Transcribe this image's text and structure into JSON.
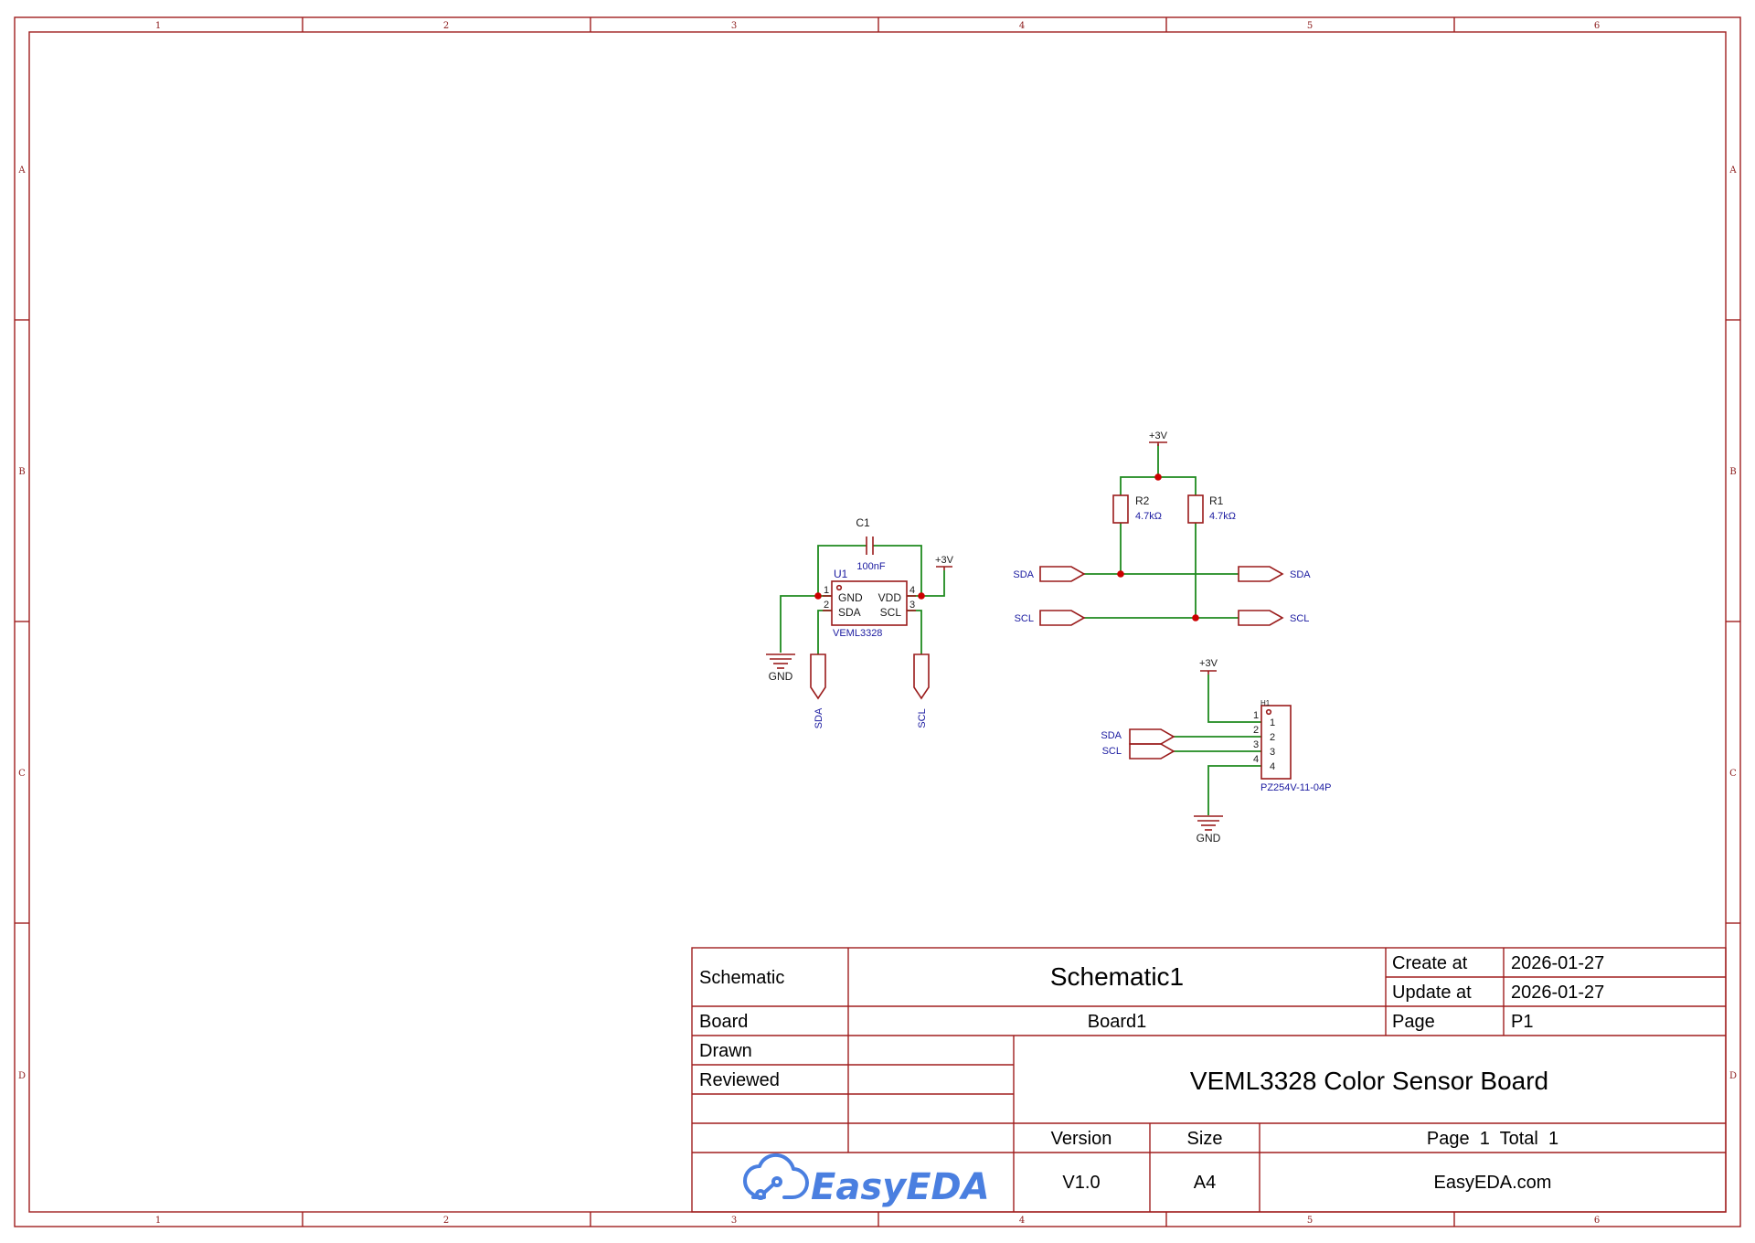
{
  "zones": {
    "columns": [
      "1",
      "2",
      "3",
      "4",
      "5",
      "6"
    ],
    "rows": [
      "A",
      "B",
      "C",
      "D"
    ]
  },
  "colors": {
    "frame": "#a01e1e",
    "wire": "#1f8a1f",
    "junction": "#cc0000",
    "net_label": "#1a1aa0",
    "logo": "#4a7fe0"
  },
  "schematic": {
    "u1": {
      "designator": "U1",
      "part": "VEML3328",
      "pins": {
        "gnd": "GND",
        "vdd": "VDD",
        "sda": "SDA",
        "scl": "SCL"
      },
      "pin_numbers": {
        "p1": "1",
        "p2": "2",
        "p3": "3",
        "p4": "4"
      }
    },
    "c1": {
      "designator": "C1",
      "value": "100nF"
    },
    "r1": {
      "designator": "R1",
      "value": "4.7kΩ"
    },
    "r2": {
      "designator": "R2",
      "value": "4.7kΩ"
    },
    "h1": {
      "designator": "H1",
      "part": "PZ254V-11-04P",
      "pin_numbers": {
        "p1": "1",
        "p2": "2",
        "p3": "3",
        "p4": "4"
      }
    },
    "power": {
      "v3": "+3V",
      "gnd": "GND"
    },
    "nets": {
      "sda": "SDA",
      "scl": "SCL"
    }
  },
  "title_block": {
    "schematic_label": "Schematic",
    "schematic_value": "Schematic1",
    "create_label": "Create at",
    "create_value": "2026-01-27",
    "update_label": "Update at",
    "update_value": "2026-01-27",
    "board_label": "Board",
    "board_value": "Board1",
    "page_label": "Page",
    "page_value": "P1",
    "drawn_label": "Drawn",
    "reviewed_label": "Reviewed",
    "title": "VEML3328 Color Sensor Board",
    "version_label": "Version",
    "version_value": "V1.0",
    "size_label": "Size",
    "size_value": "A4",
    "page_total": "Page  1  Total  1",
    "logo_text": "EasyEDA",
    "website": "EasyEDA.com"
  }
}
